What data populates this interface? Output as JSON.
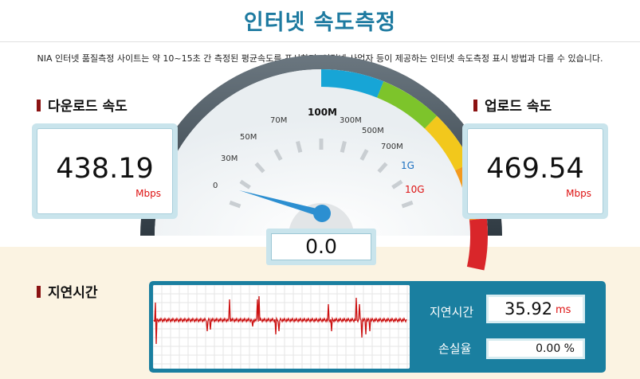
{
  "header": {
    "title": "인터넷 속도측정",
    "description": "NIA 인터넷 품질측정 사이트는 약 10~15초 간 측정된 평균속도를 표시하며, 인터넷 사업자 등이 제공하는 인터넷 속도측정 표시 방법과 다를 수 있습니다."
  },
  "download": {
    "label": "다운로드 속도",
    "value": "438.19",
    "unit": "Mbps"
  },
  "upload": {
    "label": "업로드 속도",
    "value": "469.54",
    "unit": "Mbps"
  },
  "gauge": {
    "ticks": [
      "0",
      "30M",
      "50M",
      "70M",
      "100M",
      "300M",
      "500M",
      "700M",
      "1G",
      "10G"
    ],
    "current_value": "0.0",
    "colors": {
      "blue": "#17a5d6",
      "green": "#7dc42b",
      "yellow": "#f2c81c",
      "orange": "#f39a1e",
      "red": "#d9262a",
      "needle": "#2c8fd1"
    }
  },
  "latency": {
    "section_label": "지연시간",
    "latency_label": "지연시간",
    "latency_value": "35.92",
    "latency_unit": "ms",
    "loss_label": "손실율",
    "loss_value": "0.00 %"
  },
  "colors": {
    "title": "#1d7aa0",
    "panel": "#1a7fa0",
    "accent_red": "#dd1111"
  }
}
